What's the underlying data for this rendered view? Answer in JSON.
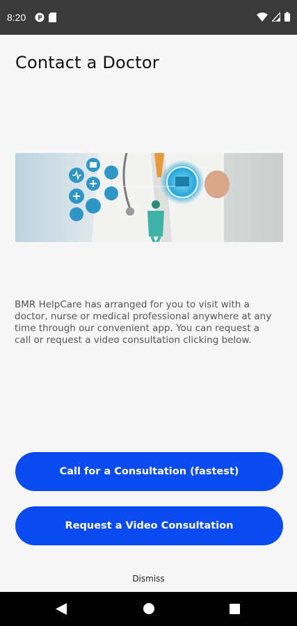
{
  "status_bar": {
    "time": "8:20",
    "icons_left": [
      "data-saver-icon",
      "sim-card-icon"
    ],
    "icons_right": [
      "wifi-icon",
      "cell-signal-icon",
      "battery-icon"
    ]
  },
  "page": {
    "title": "Contact a Doctor",
    "hero_image": "doctor-with-medical-icons-illustration",
    "description": "BMR HelpCare has arranged for you to visit with a doctor, nurse or medical professional anywhere at any time through our convenient app. You can request a call or request a video consultation clicking below."
  },
  "actions": {
    "call_label": "Call for a Consultation (fastest)",
    "video_label": "Request a Video Consultation",
    "dismiss_label": "Dismiss"
  },
  "colors": {
    "primary_button": "#0a4bf0",
    "status_bar": "#3a3a3a",
    "background": "#f7f7f7"
  },
  "nav_bar": {
    "buttons": [
      "back-icon",
      "home-icon",
      "recents-icon"
    ]
  }
}
